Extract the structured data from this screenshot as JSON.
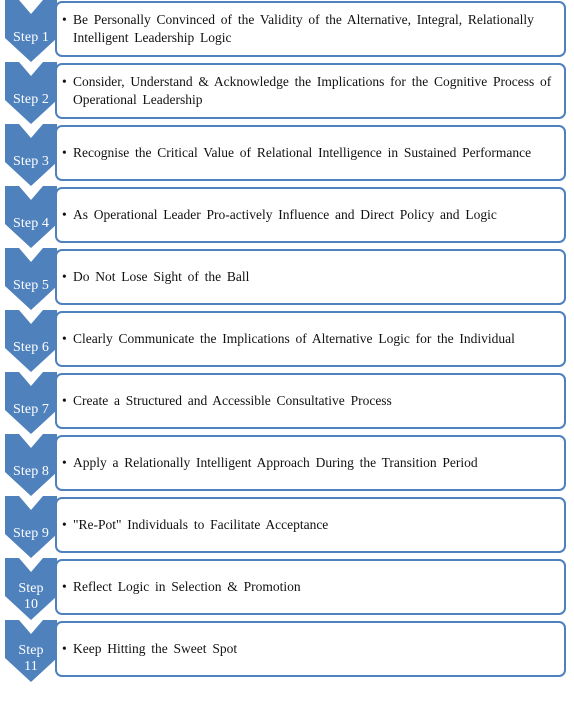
{
  "diagram": {
    "title": "Eleven-Step Relationally Intelligent Leadership Process",
    "type": "vertical-process-chevron-list",
    "accent_color": "#4F81BD",
    "box_border_color": "#4F81BD",
    "box_fill_color": "#FFFFFF",
    "label_text_color": "#FFFFFF",
    "body_text_color": "#111111",
    "bullet_glyph": "•",
    "steps": [
      {
        "label": "Step 1",
        "label_lines": [
          "Step 1"
        ],
        "text": "Be Personally Convinced of the Validity of the Alternative, Integral, Relationally Intelligent Leadership Logic"
      },
      {
        "label": "Step 2",
        "label_lines": [
          "Step 2"
        ],
        "text": "Consider, Understand & Acknowledge the Implications for the Cognitive Process of Operational Leadership"
      },
      {
        "label": "Step 3",
        "label_lines": [
          "Step 3"
        ],
        "text": "Recognise the Critical Value of Relational Intelligence in Sustained Performance"
      },
      {
        "label": "Step 4",
        "label_lines": [
          "Step 4"
        ],
        "text": "As Operational Leader Pro-actively Influence and Direct Policy and Logic"
      },
      {
        "label": "Step 5",
        "label_lines": [
          "Step 5"
        ],
        "text": "Do Not Lose Sight of the Ball"
      },
      {
        "label": "Step 6",
        "label_lines": [
          "Step 6"
        ],
        "text": "Clearly Communicate the Implications of Alternative Logic for the Individual"
      },
      {
        "label": "Step 7",
        "label_lines": [
          "Step 7"
        ],
        "text": "Create a Structured and Accessible Consultative Process"
      },
      {
        "label": "Step 8",
        "label_lines": [
          "Step 8"
        ],
        "text": "Apply a Relationally Intelligent Approach During the Transition Period"
      },
      {
        "label": "Step 9",
        "label_lines": [
          "Step 9"
        ],
        "text": "\"Re-Pot\" Individuals to Facilitate Acceptance"
      },
      {
        "label": "Step 10",
        "label_lines": [
          "Step",
          "10"
        ],
        "text": "Reflect Logic in Selection & Promotion"
      },
      {
        "label": "Step 11",
        "label_lines": [
          "Step",
          "11"
        ],
        "text": "Keep Hitting the Sweet Spot"
      }
    ]
  }
}
